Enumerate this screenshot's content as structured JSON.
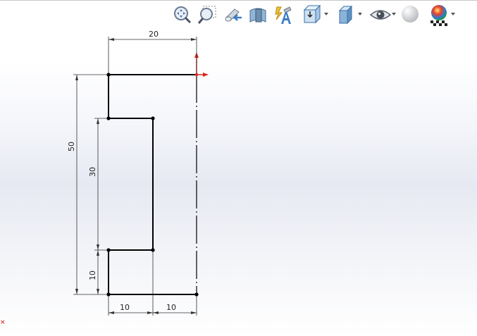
{
  "toolbar": {
    "tools": [
      {
        "name": "zoom-to-fit"
      },
      {
        "name": "zoom-to-area"
      },
      {
        "name": "previous-view"
      },
      {
        "name": "section-view"
      },
      {
        "name": "dynamic-annotation-views"
      },
      {
        "name": "view-orientation",
        "dropdown": true
      },
      {
        "name": "display-style",
        "dropdown": true
      },
      {
        "name": "hide-show-items",
        "dropdown": true
      },
      {
        "name": "edit-appearance"
      },
      {
        "name": "apply-scene",
        "dropdown": true
      }
    ]
  },
  "sketch": {
    "dimensions": {
      "top_width": "20",
      "total_height": "50",
      "inner_height": "30",
      "bottom_height": "10",
      "bottom_left": "10",
      "bottom_right": "10"
    },
    "colors": {
      "line": "#000000",
      "dimension": "#333333",
      "origin": "#d9251d"
    }
  },
  "status": {
    "corner_mark": "×"
  }
}
